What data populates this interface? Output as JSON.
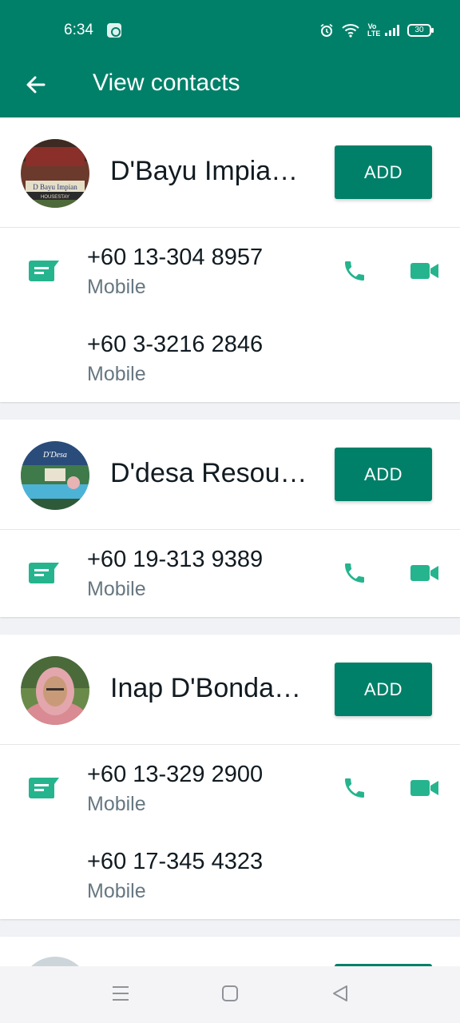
{
  "status_bar": {
    "time": "6:34",
    "battery": "30"
  },
  "app_bar": {
    "title": "View contacts"
  },
  "contacts": [
    {
      "name": "D'Bayu Impia…",
      "add_label": "ADD",
      "phones": [
        {
          "number": "+60 13-304 8957",
          "type": "Mobile"
        },
        {
          "number": "+60 3-3216 2846",
          "type": "Mobile"
        }
      ]
    },
    {
      "name": "D'desa Resou…",
      "add_label": "ADD",
      "phones": [
        {
          "number": "+60 19-313 9389",
          "type": "Mobile"
        }
      ]
    },
    {
      "name": "Inap D'Bonda…",
      "add_label": "ADD",
      "phones": [
        {
          "number": "+60 13-329 2900",
          "type": "Mobile"
        },
        {
          "number": "+60 17-345 4323",
          "type": "Mobile"
        }
      ]
    }
  ],
  "colors": {
    "brand": "#008069",
    "accent": "#25b48e",
    "text_primary": "#111b21",
    "text_secondary": "#667781"
  }
}
